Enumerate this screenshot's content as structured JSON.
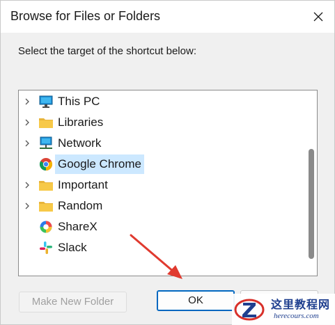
{
  "window": {
    "title": "Browse for Files or Folders",
    "close_glyph": "✕"
  },
  "instruction": "Select the target of the shortcut below:",
  "tree": {
    "items": [
      {
        "label": "This PC",
        "icon": "monitor-icon",
        "expandable": true,
        "selected": false
      },
      {
        "label": "Libraries",
        "icon": "folder-icon",
        "expandable": true,
        "selected": false
      },
      {
        "label": "Network",
        "icon": "network-icon",
        "expandable": true,
        "selected": false
      },
      {
        "label": "Google Chrome",
        "icon": "chrome-icon",
        "expandable": false,
        "selected": true
      },
      {
        "label": "Important",
        "icon": "folder-icon",
        "expandable": true,
        "selected": false
      },
      {
        "label": "Random",
        "icon": "folder-icon",
        "expandable": true,
        "selected": false
      },
      {
        "label": "ShareX",
        "icon": "sharex-icon",
        "expandable": false,
        "selected": false
      },
      {
        "label": "Slack",
        "icon": "slack-icon",
        "expandable": false,
        "selected": false
      }
    ]
  },
  "buttons": {
    "make_new_folder": "Make New Folder",
    "ok": "OK",
    "cancel": ""
  },
  "watermark": {
    "title": "这里教程网",
    "url": "herecours.com"
  },
  "colors": {
    "selection": "#cce8ff",
    "ok_border": "#0067c0",
    "annotation_arrow": "#e03a2f",
    "folder": "#f7c948"
  }
}
